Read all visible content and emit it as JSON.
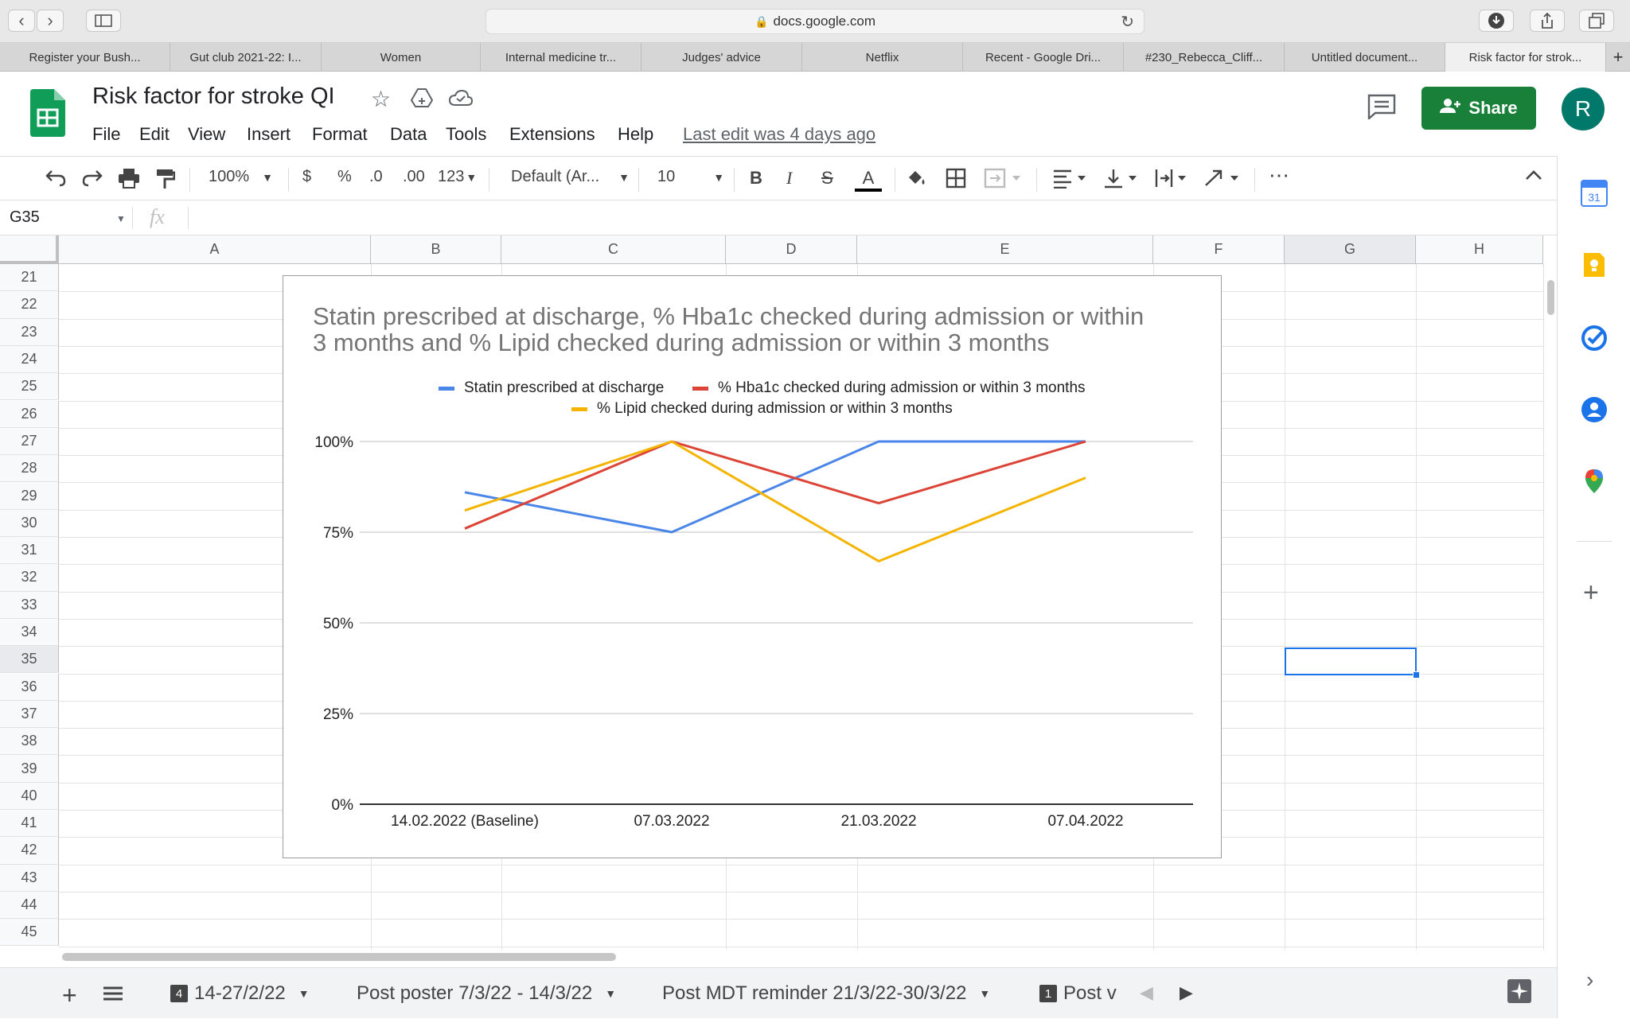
{
  "browser": {
    "url": "docs.google.com",
    "tabs": [
      {
        "label": "Register your Bush..."
      },
      {
        "label": "Gut club 2021-22: I..."
      },
      {
        "label": "Women"
      },
      {
        "label": "Internal medicine tr..."
      },
      {
        "label": "Judges' advice"
      },
      {
        "label": "Netflix"
      },
      {
        "label": "Recent - Google Dri..."
      },
      {
        "label": "#230_Rebecca_Cliff..."
      },
      {
        "label": "Untitled document..."
      },
      {
        "label": "Risk factor for strok..."
      }
    ]
  },
  "doc": {
    "title": "Risk factor for stroke QI",
    "menu": [
      "File",
      "Edit",
      "View",
      "Insert",
      "Format",
      "Data",
      "Tools",
      "Extensions",
      "Help"
    ],
    "last_edit": "Last edit was 4 days ago",
    "share_label": "Share",
    "avatar_letter": "R"
  },
  "toolbar": {
    "zoom": "100%",
    "currency": "$",
    "percent": "%",
    "decrease_decimal": ".0",
    "increase_decimal": ".00",
    "more_formats": "123",
    "font": "Default (Ar...",
    "font_size": "10",
    "bold": "B",
    "italic": "I",
    "strike": "S",
    "text_color": "A",
    "more": "⋯"
  },
  "formula_bar": {
    "cell_ref": "G35",
    "fx": "fx",
    "value": ""
  },
  "grid": {
    "columns": [
      "A",
      "B",
      "C",
      "D",
      "E",
      "F",
      "G",
      "H"
    ],
    "rows": [
      "21",
      "22",
      "23",
      "24",
      "25",
      "26",
      "27",
      "28",
      "29",
      "30",
      "31",
      "32",
      "33",
      "34",
      "35",
      "36",
      "37",
      "38",
      "39",
      "40",
      "41",
      "42",
      "43",
      "44",
      "45"
    ],
    "selected_cell": "G35"
  },
  "sheet_tabs": {
    "tabs": [
      {
        "badge": "4",
        "label": "14-27/2/22"
      },
      {
        "badge": "",
        "label": "Post poster 7/3/22 - 14/3/22"
      },
      {
        "badge": "",
        "label": "Post MDT reminder 21/3/22-30/3/22"
      },
      {
        "badge": "1",
        "label": "Post v"
      }
    ]
  },
  "chart_data": {
    "type": "line",
    "title": "Statin prescribed at discharge, % Hba1c checked during admission or within 3 months and % Lipid checked during admission or within 3 months",
    "title_lines": [
      "Statin prescribed at discharge, % Hba1c checked during admission or within",
      "3 months and % Lipid checked during admission or within 3 months"
    ],
    "categories": [
      "14.02.2022 (Baseline)",
      "07.03.2022",
      "21.03.2022",
      "07.04.2022"
    ],
    "series": [
      {
        "name": "Statin prescribed at discharge",
        "color": "#4a86e8",
        "values": [
          0.86,
          0.75,
          1.0,
          1.0
        ]
      },
      {
        "name": "% Hba1c checked during admission or within 3 months",
        "color": "#db4437",
        "values": [
          0.76,
          1.0,
          0.83,
          1.0
        ]
      },
      {
        "name": "% Lipid checked during admission or within 3 months",
        "color": "#f4b400",
        "values": [
          0.81,
          1.0,
          0.67,
          0.9
        ]
      }
    ],
    "yticks": [
      "100%",
      "75%",
      "50%",
      "25%",
      "0%"
    ],
    "ylim": [
      0,
      1
    ],
    "grid": true,
    "legend_position": "top"
  },
  "colors": {
    "share_button": "#188038",
    "sheets_green": "#0f9d58",
    "selection": "#1a73e8"
  }
}
